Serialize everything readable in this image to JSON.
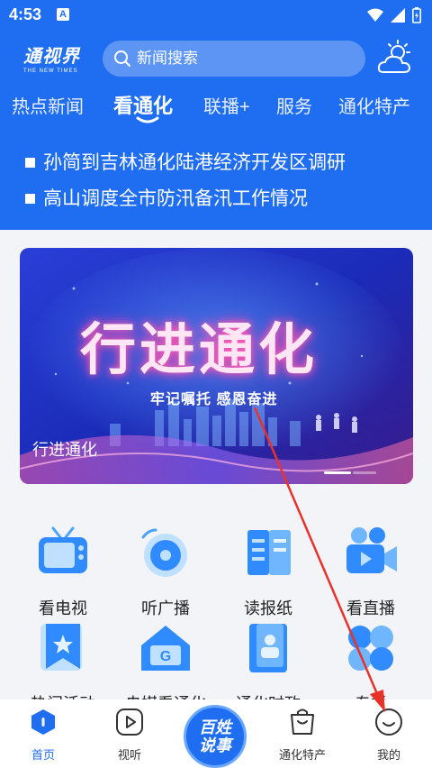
{
  "status_bar": {
    "time": "4:53",
    "app_indicator": "A"
  },
  "header": {
    "logo_cn": "通视界",
    "logo_en": "THE NEW TIMES",
    "search_placeholder": "新闻搜索",
    "weather_icon": "weather-cloud-sun-icon"
  },
  "tabs": [
    {
      "label": "热点新闻",
      "active": false
    },
    {
      "label": "看通化",
      "active": true
    },
    {
      "label": "联播+",
      "active": false
    },
    {
      "label": "服务",
      "active": false
    },
    {
      "label": "通化特产",
      "active": false
    }
  ],
  "headlines": [
    "孙简到吉林通化陆港经济开发区调研",
    "高山调度全市防汛备汛工作情况"
  ],
  "banner": {
    "title": "行进通化",
    "subtitle": "牢记嘱托 感恩奋进",
    "caption": "行进通化"
  },
  "grid": [
    {
      "label": "看电视",
      "icon": "tv-icon"
    },
    {
      "label": "听广播",
      "icon": "radio-icon"
    },
    {
      "label": "读报纸",
      "icon": "newspaper-icon"
    },
    {
      "label": "看直播",
      "icon": "live-camera-icon"
    },
    {
      "label": "热门活动",
      "icon": "event-bookmark-icon"
    },
    {
      "label": "央媒看通化",
      "icon": "media-house-icon"
    },
    {
      "label": "通化时政",
      "icon": "politics-doc-icon"
    },
    {
      "label": "专栏",
      "icon": "column-grid-icon"
    }
  ],
  "bottom_nav": [
    {
      "label": "首页",
      "icon": "home-icon",
      "active": true
    },
    {
      "label": "视听",
      "icon": "play-icon",
      "active": false
    },
    {
      "label": "通化特产",
      "icon": "shopping-bag-icon",
      "active": false
    },
    {
      "label": "我的",
      "icon": "profile-smile-icon",
      "active": false
    }
  ],
  "center_button": {
    "line1": "百姓",
    "line2": "说事"
  },
  "colors": {
    "brand": "#1f6df0",
    "annotation_arrow": "#e8322a"
  }
}
